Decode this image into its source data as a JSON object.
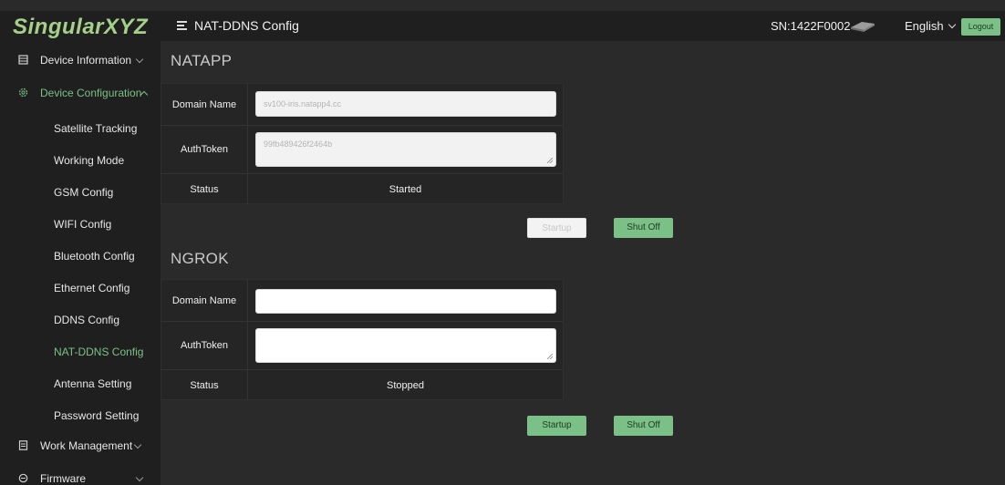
{
  "header": {
    "logo": "SingularXYZ",
    "page_title": "NAT-DDNS Config",
    "serial": "SN:1422F0002",
    "language": "English",
    "logout_label": "Logout"
  },
  "sidebar": {
    "groups": [
      {
        "label": "Device Information",
        "icon": "list-icon",
        "expanded": false
      },
      {
        "label": "Device Configuration",
        "icon": "gear-icon",
        "expanded": true
      },
      {
        "label": "Work Management",
        "icon": "document-icon",
        "expanded": false
      },
      {
        "label": "Firmware",
        "icon": "firmware-icon",
        "expanded": false
      }
    ],
    "sub_items": [
      "Satellite Tracking",
      "Working Mode",
      "GSM Config",
      "WIFI Config",
      "Bluetooth Config",
      "Ethernet Config",
      "DDNS Config",
      "NAT-DDNS Config",
      "Antenna Setting",
      "Password Setting"
    ],
    "active_item": "NAT-DDNS Config"
  },
  "natapp": {
    "title": "NATAPP",
    "domain_label": "Domain Name",
    "domain_value": "sv100-iris.natapp4.cc",
    "token_label": "AuthToken",
    "token_value": "99fb489426f2464b",
    "status_label": "Status",
    "status_value": "Started",
    "startup_label": "Startup",
    "shutoff_label": "Shut Off"
  },
  "ngrok": {
    "title": "NGROK",
    "domain_label": "Domain Name",
    "domain_value": "",
    "token_label": "AuthToken",
    "token_value": "",
    "status_label": "Status",
    "status_value": "Stopped",
    "startup_label": "Startup",
    "shutoff_label": "Shut Off"
  },
  "colors": {
    "accent": "#7bc087",
    "logo": "#a6d08a",
    "background": "#2a2a2a",
    "panel": "#1f1f1f"
  }
}
